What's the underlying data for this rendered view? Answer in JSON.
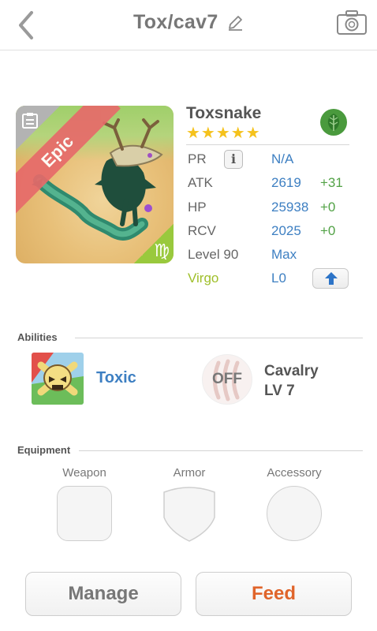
{
  "header": {
    "title": "Tox/cav7",
    "back_icon": "chevron-left-icon",
    "edit_icon": "pencil-icon",
    "camera_icon": "camera-icon"
  },
  "monster": {
    "rarity": "Epic",
    "sign_glyph": "♍",
    "name": "Toxsnake",
    "stars": "★★★★★",
    "star_count": 5,
    "element_icon": "leaf-icon",
    "element_color": "#4a9a3d"
  },
  "stats": {
    "pr": {
      "label": "PR",
      "value": "N/A",
      "info_glyph": "i"
    },
    "atk": {
      "label": "ATK",
      "value": "2619",
      "bonus": "+31"
    },
    "hp": {
      "label": "HP",
      "value": "25938",
      "bonus": "+0"
    },
    "rcv": {
      "label": "RCV",
      "value": "2025",
      "bonus": "+0"
    },
    "level": {
      "label": "Level 90",
      "value": "Max"
    },
    "sign": {
      "label": "Virgo",
      "value": "L0"
    }
  },
  "abilities": {
    "section_label": "Abilities",
    "skill_name": "Toxic",
    "awaken_state": "OFF",
    "awaken_name": "Cavalry",
    "awaken_level": "LV 7"
  },
  "equipment": {
    "section_label": "Equipment",
    "slots": [
      "Weapon",
      "Armor",
      "Accessory"
    ]
  },
  "actions": {
    "manage": "Manage",
    "feed": "Feed"
  },
  "colors": {
    "value_blue": "#3d7fc2",
    "bonus_green": "#52a246",
    "feed_orange": "#e0642a",
    "epic_red": "#e66a6a",
    "virgo_green": "#99c93d"
  }
}
